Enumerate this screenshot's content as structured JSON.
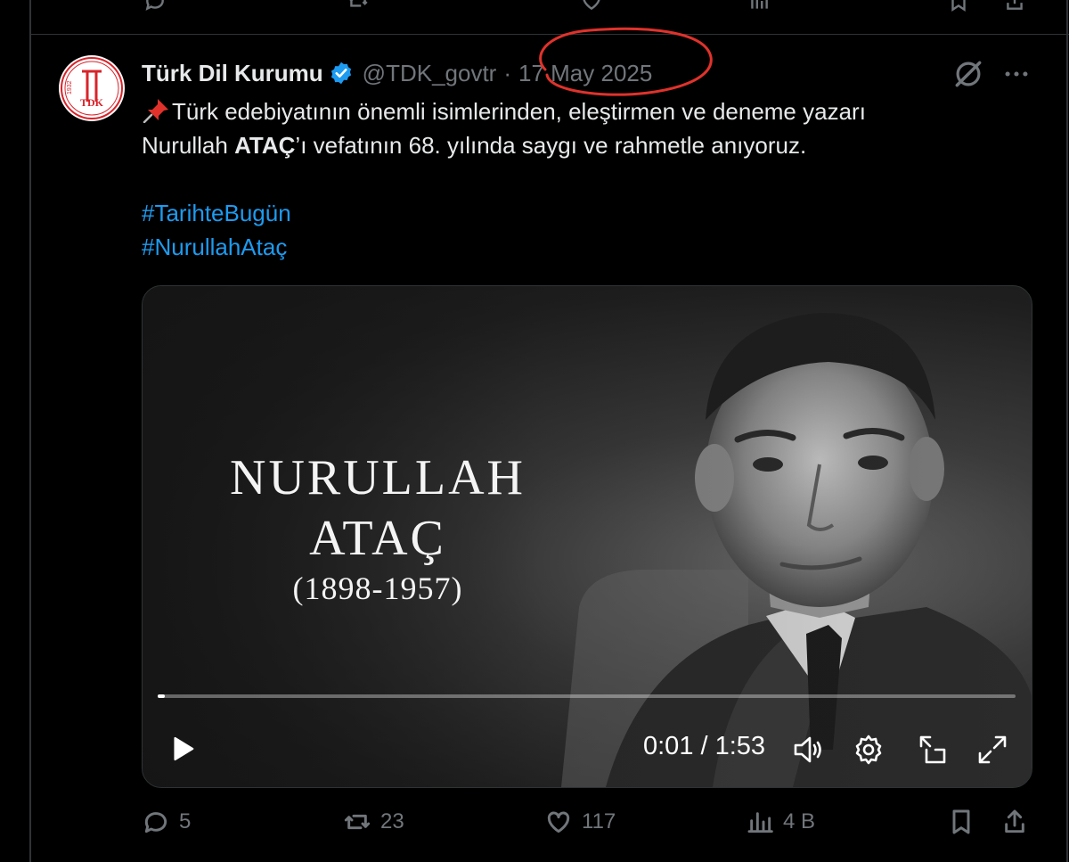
{
  "colors": {
    "accent": "#1d9bf0",
    "muted": "#71767b",
    "text": "#e7e9ea",
    "annotation": "#e0322b",
    "brand": "#d8232a"
  },
  "tweet": {
    "author_name": "Türk Dil Kurumu",
    "handle": "@TDK_govtr",
    "separator": "·",
    "date": "17 May 2025",
    "avatar_logo": {
      "year": "1932",
      "letters": "TDK"
    },
    "text_line_1": "Türk edebiyatının önemli isimlerinden, eleştirmen ve deneme yazarı",
    "text_line_2_before": "Nurullah ",
    "text_line_2_bold": "ATAÇ",
    "text_line_2_after": "’ı vefatının 68. yılında saygı ve rahmetle anıyoruz.",
    "hashtags": [
      "#TarihteBugün",
      "#NurullahAtaç"
    ],
    "icons": [
      "verified-badge-icon",
      "grok-icon",
      "more-icon",
      "pin-icon"
    ]
  },
  "video": {
    "title_first": "NURULLAH",
    "title_last": "ATAÇ",
    "years": "(1898-1957)",
    "time_display": "0:01 / 1:53",
    "progress": 0.003,
    "icons": [
      "play-icon",
      "volume-icon",
      "settings-icon",
      "pip-icon",
      "fullscreen-icon"
    ]
  },
  "actions": {
    "replies": "5",
    "reposts": "23",
    "likes": "117",
    "views": "4 B"
  }
}
